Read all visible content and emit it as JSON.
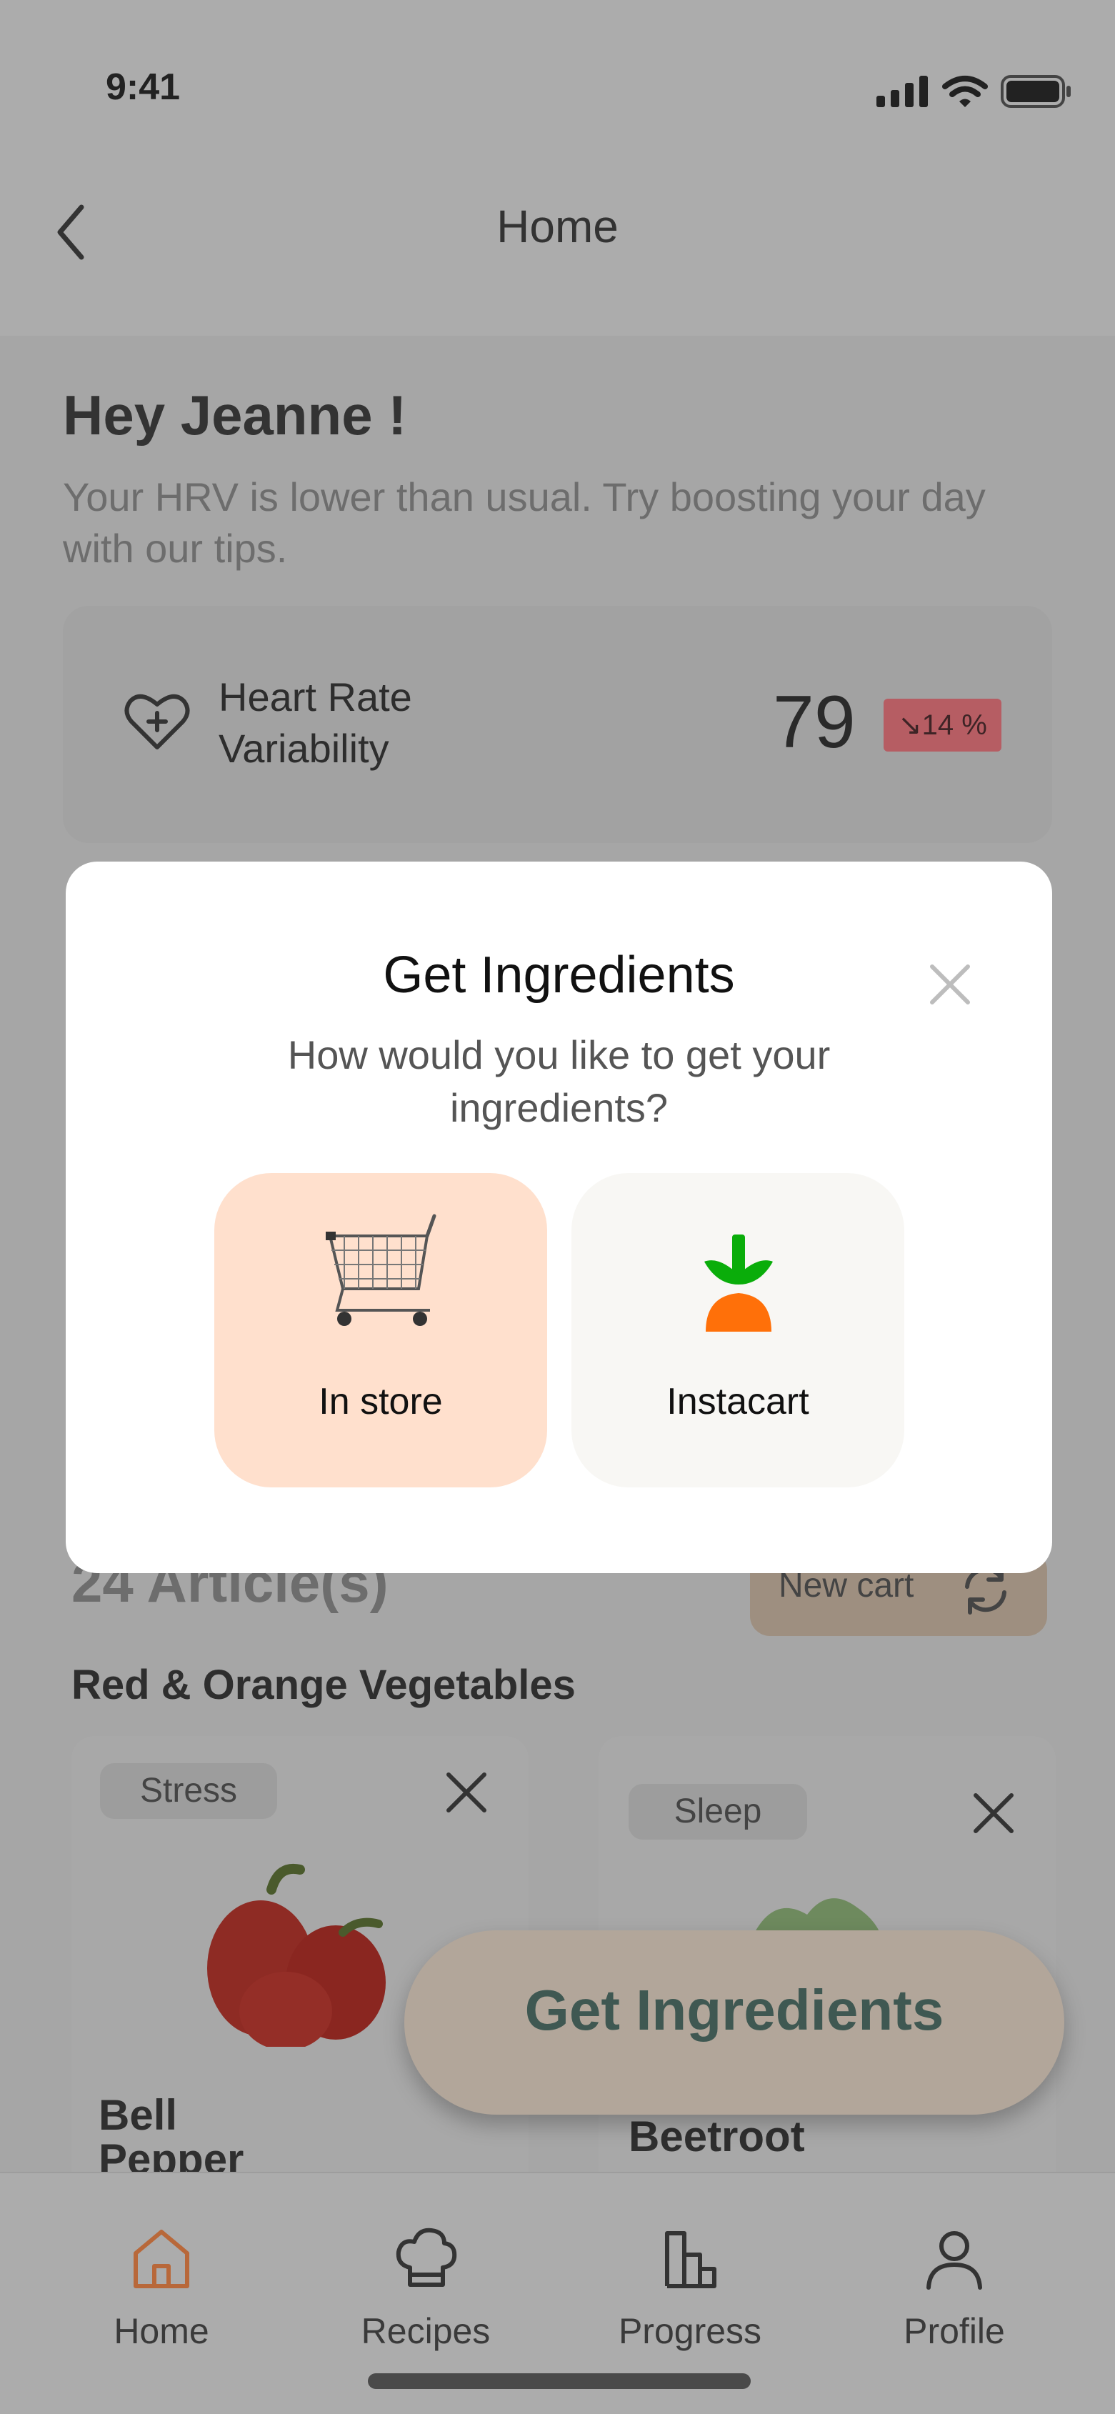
{
  "status_bar": {
    "time": "9:41"
  },
  "header": {
    "title": "Home"
  },
  "greeting": {
    "title": "Hey Jeanne !",
    "subtitle": "Your HRV is lower than usual. Try boosting your day with our tips."
  },
  "hrv_card": {
    "label": "Heart Rate Variability",
    "value": "79",
    "change": "↘14 %",
    "change_color": "#b65d63"
  },
  "articles": {
    "count_label": "24 Article(s)",
    "new_cart_label": "New cart"
  },
  "section_title": "Red & Orange Vegetables",
  "vegetables": [
    {
      "tag": "Stress",
      "name": "Bell Pepper"
    },
    {
      "tag": "Sleep",
      "name": "Beetroot"
    }
  ],
  "fab": {
    "label": "Get Ingredients"
  },
  "modal": {
    "title": "Get Ingredients",
    "subtitle": "How would you like to get your ingredients?",
    "options": [
      {
        "label": "In store",
        "icon": "shopping-cart-icon",
        "bg": "#ffe0cd"
      },
      {
        "label": "Instacart",
        "icon": "instacart-carrot-icon",
        "bg": "#f8f7f4"
      }
    ]
  },
  "tabs": [
    {
      "label": "Home",
      "icon": "home-icon",
      "active": true,
      "color": "#b8683a"
    },
    {
      "label": "Recipes",
      "icon": "chef-hat-icon"
    },
    {
      "label": "Progress",
      "icon": "bar-chart-icon"
    },
    {
      "label": "Profile",
      "icon": "user-icon"
    }
  ]
}
